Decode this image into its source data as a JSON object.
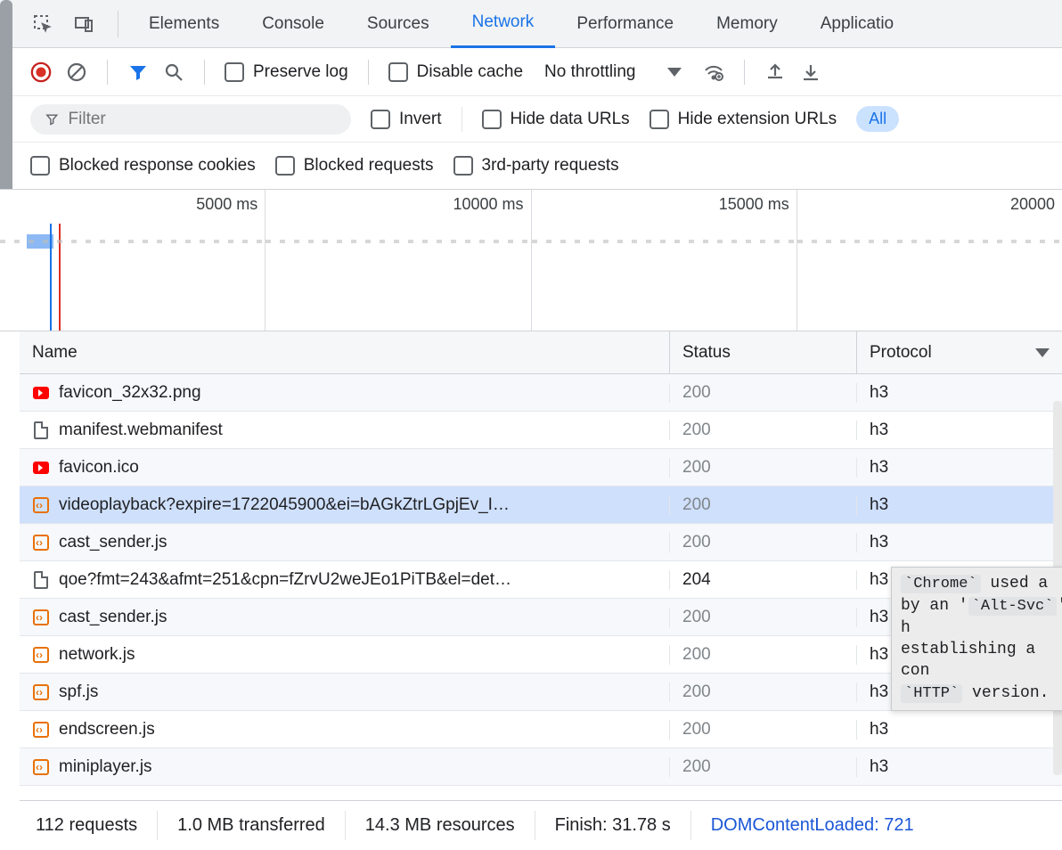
{
  "tabs": {
    "elements": "Elements",
    "console": "Console",
    "sources": "Sources",
    "network": "Network",
    "performance": "Performance",
    "memory": "Memory",
    "application": "Applicatio"
  },
  "toolbar": {
    "preserve_log": "Preserve log",
    "disable_cache": "Disable cache",
    "throttling": "No throttling"
  },
  "filter": {
    "placeholder": "Filter",
    "invert": "Invert",
    "hide_data_urls": "Hide data URLs",
    "hide_ext_urls": "Hide extension URLs",
    "all_chip": "All",
    "blocked_response_cookies": "Blocked response cookies",
    "blocked_requests": "Blocked requests",
    "third_party": "3rd-party requests"
  },
  "overview": {
    "ticks": [
      "5000 ms",
      "10000 ms",
      "15000 ms",
      "20000"
    ]
  },
  "columns": {
    "name": "Name",
    "status": "Status",
    "protocol": "Protocol"
  },
  "rows": [
    {
      "icon": "yt",
      "name": "favicon_32x32.png",
      "status": "200",
      "status_strong": false,
      "proto": "h3"
    },
    {
      "icon": "doc",
      "name": "manifest.webmanifest",
      "status": "200",
      "status_strong": false,
      "proto": "h3"
    },
    {
      "icon": "yt",
      "name": "favicon.ico",
      "status": "200",
      "status_strong": false,
      "proto": "h3"
    },
    {
      "icon": "js",
      "name": "videoplayback?expire=1722045900&ei=bAGkZtrLGpjEv_I…",
      "status": "200",
      "status_strong": false,
      "proto": "h3",
      "selected": true
    },
    {
      "icon": "js",
      "name": "cast_sender.js",
      "status": "200",
      "status_strong": false,
      "proto": "h3"
    },
    {
      "icon": "doc",
      "name": "qoe?fmt=243&afmt=251&cpn=fZrvU2weJEo1PiTB&el=det…",
      "status": "204",
      "status_strong": true,
      "proto": "h3"
    },
    {
      "icon": "js",
      "name": "cast_sender.js",
      "status": "200",
      "status_strong": false,
      "proto": "h3"
    },
    {
      "icon": "js",
      "name": "network.js",
      "status": "200",
      "status_strong": false,
      "proto": "h3"
    },
    {
      "icon": "js",
      "name": "spf.js",
      "status": "200",
      "status_strong": false,
      "proto": "h3"
    },
    {
      "icon": "js",
      "name": "endscreen.js",
      "status": "200",
      "status_strong": false,
      "proto": "h3"
    },
    {
      "icon": "js",
      "name": "miniplayer.js",
      "status": "200",
      "status_strong": false,
      "proto": "h3"
    }
  ],
  "tooltip": {
    "line1_a": "`Chrome`",
    "line1_b": " used a ",
    "line2_a": "by an '",
    "line2_b": "`Alt-Svc`",
    "line2_c": "' h",
    "line3": "establishing a con",
    "line4_a": "`HTTP`",
    "line4_b": " version."
  },
  "status": {
    "requests": "112 requests",
    "transferred": "1.0 MB transferred",
    "resources": "14.3 MB resources",
    "finish": "Finish: 31.78 s",
    "dcl": "DOMContentLoaded: 721"
  }
}
